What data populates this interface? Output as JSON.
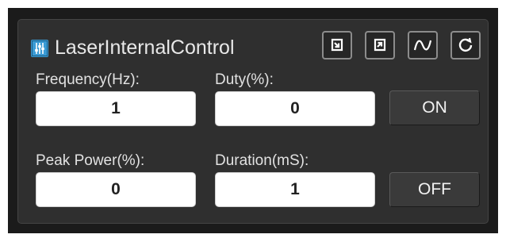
{
  "panel": {
    "title": "LaserInternalControl",
    "icon": "laser-control-icon",
    "accent_color": "#3a9bd5"
  },
  "toolbar": [
    {
      "name": "import-icon",
      "tooltip": ""
    },
    {
      "name": "export-icon",
      "tooltip": ""
    },
    {
      "name": "waveform-icon",
      "tooltip": ""
    },
    {
      "name": "refresh-icon",
      "tooltip": ""
    }
  ],
  "fields": {
    "frequency": {
      "label": "Frequency(Hz):",
      "value": "1"
    },
    "duty": {
      "label": "Duty(%):",
      "value": "0"
    },
    "peak_power": {
      "label": "Peak Power(%):",
      "value": "0"
    },
    "duration": {
      "label": "Duration(mS):",
      "value": "1"
    }
  },
  "buttons": {
    "on": "ON",
    "off": "OFF"
  }
}
